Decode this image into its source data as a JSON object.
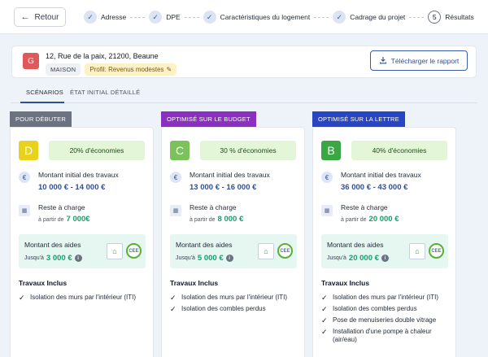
{
  "colors": {
    "accent": "#2d4f9e",
    "badge_debuter": "#6b7280",
    "badge_budget": "#8a2fbf",
    "badge_lettre": "#2846c4",
    "dpe_D": "#e8d21b",
    "dpe_C": "#7cc25a",
    "dpe_B": "#3aa644",
    "savings_bg": "#e3f6d8",
    "aides_bg": "#e6f6f0"
  },
  "header": {
    "back_label": "Retour",
    "back_icon": "arrow-left-icon",
    "steps": [
      {
        "label": "Adresse",
        "icon": "check-icon",
        "marker": "✓"
      },
      {
        "label": "DPE",
        "icon": "check-icon",
        "marker": "✓"
      },
      {
        "label": "Caractéristiques du logement",
        "icon": "check-icon",
        "marker": "✓"
      },
      {
        "label": "Cadrage du projet",
        "icon": "check-icon",
        "marker": "✓"
      },
      {
        "label": "Résultats",
        "icon": "number-icon",
        "marker": "5"
      }
    ]
  },
  "address": {
    "avatar_letter": "G",
    "text": "12, Rue de la paix, 21200, Beaune",
    "type_tag": "MAISON",
    "profile_tag": "Profil: Revenus modestes",
    "profile_icon": "pencil-icon",
    "download_label": "Télécharger le rapport",
    "download_icon": "download-icon"
  },
  "tabs": [
    {
      "label": "SCÉNARIOS",
      "active": true
    },
    {
      "label": "ÉTAT INITIAL DÉTAILLÉ",
      "active": false
    }
  ],
  "scenarios": [
    {
      "badge": "POUR DÉBUTER",
      "dpe": "D",
      "savings": "20% d'économies",
      "montant_label": "Montant initial des travaux",
      "montant_value": "10 000 € - 14 000 €",
      "reste_label": "Reste à charge",
      "reste_prefix": "à partir de",
      "reste_value": "7 000€",
      "aides_label": "Montant des aides",
      "aides_prefix": "Jusqu'à",
      "aides_value": "3 000 €",
      "aides_info": "i",
      "cee_label": "CEE",
      "travaux_title": "Travaux Inclus",
      "travaux": [
        "Isolation des murs par l'intérieur (ITI)"
      ]
    },
    {
      "badge": "OPTIMISÉ SUR LE BUDGET",
      "dpe": "C",
      "savings": "30 % d'économies",
      "montant_label": "Montant initial des travaux",
      "montant_value": "13 000 € - 16 000 €",
      "reste_label": "Reste à charge",
      "reste_prefix": "à partir de",
      "reste_value": "8 000 €",
      "aides_label": "Montant des aides",
      "aides_prefix": "Jusqu'à",
      "aides_value": "5 000 €",
      "aides_info": "i",
      "cee_label": "CEE",
      "travaux_title": "Travaux Inclus",
      "travaux": [
        "Isolation des murs par l'intérieur (ITI)",
        "Isolation des combles perdus"
      ]
    },
    {
      "badge": "OPTIMISÉ SUR LA LETTRE",
      "dpe": "B",
      "savings": "40% d'économies",
      "montant_label": "Montant initial des travaux",
      "montant_value": "36 000 € - 43 000 €",
      "reste_label": "Reste à charge",
      "reste_prefix": "à partir de",
      "reste_value": "20 000 €",
      "aides_label": "Montant des aides",
      "aides_prefix": "Jusqu'à",
      "aides_value": "20 000 €",
      "aides_info": "i",
      "cee_label": "CEE",
      "travaux_title": "Travaux Inclus",
      "travaux": [
        "Isolation des murs par l'intérieur (ITI)",
        "Isolation des combles perdus",
        "Pose de menuiseries double vitrage",
        "Installation d'une pompe à chaleur (air/eau)"
      ]
    }
  ]
}
